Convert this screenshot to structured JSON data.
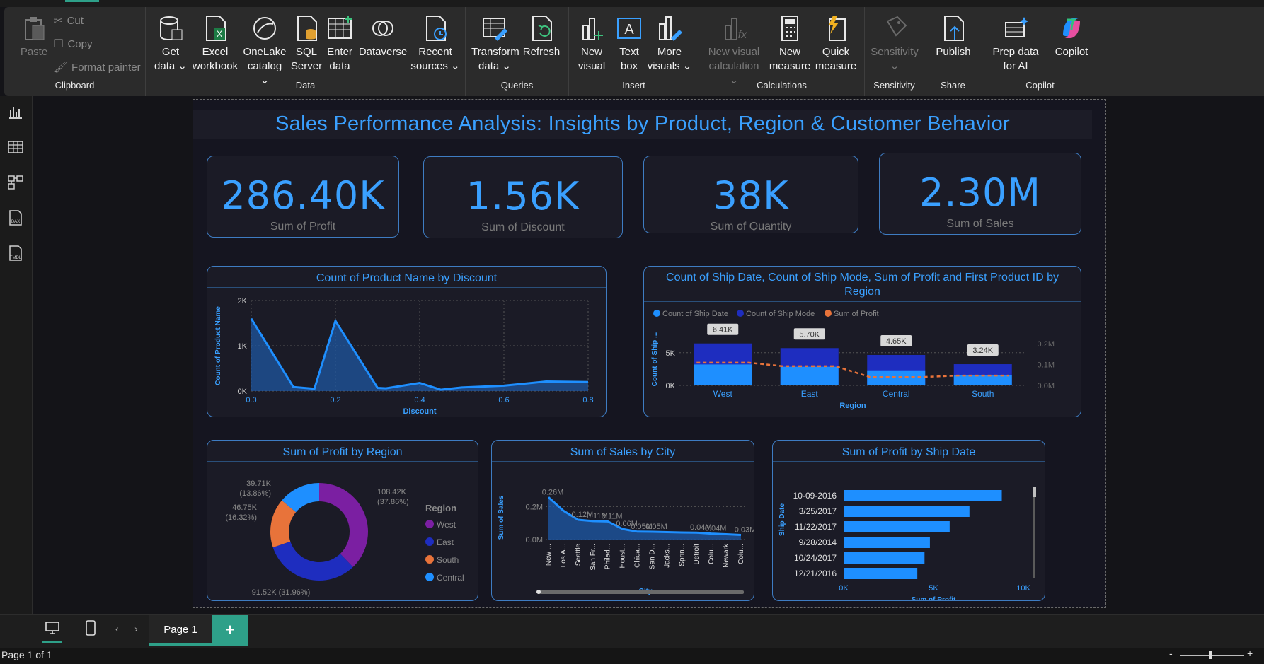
{
  "ribbon": {
    "clipboard": {
      "paste": "Paste",
      "cut": "Cut",
      "copy": "Copy",
      "format_painter": "Format painter",
      "label": "Clipboard"
    },
    "data": {
      "get_data": "Get data ⌄",
      "excel": "Excel workbook",
      "onelake": "OneLake catalog ⌄",
      "sql": "SQL Server",
      "enter": "Enter data",
      "dataverse": "Dataverse",
      "recent": "Recent sources ⌄",
      "label": "Data"
    },
    "queries": {
      "transform": "Transform data ⌄",
      "refresh": "Refresh",
      "label": "Queries"
    },
    "insert": {
      "new_visual": "New visual",
      "text_box": "Text box",
      "more_visuals": "More visuals ⌄",
      "label": "Insert"
    },
    "calculations": {
      "new_visual_calc": "New visual calculation ⌄",
      "new_measure": "New measure",
      "quick_measure": "Quick measure",
      "label": "Calculations"
    },
    "sensitivity": {
      "btn": "Sensitivity ⌄",
      "label": "Sensitivity"
    },
    "share": {
      "publish": "Publish",
      "label": "Share"
    },
    "copilot": {
      "prep": "Prep data for AI",
      "copilot": "Copilot",
      "label": "Copilot"
    }
  },
  "report": {
    "title": "Sales Performance Analysis: Insights by Product, Region & Customer Behavior",
    "cards": [
      {
        "value": "286.40K",
        "label": "Sum of Profit"
      },
      {
        "value": "1.56K",
        "label": "Sum of Discount"
      },
      {
        "value": "38K",
        "label": "Sum of Quantity"
      },
      {
        "value": "2.30M",
        "label": "Sum of Sales"
      }
    ],
    "panels": {
      "discount_title": "Count of Product Name by Discount",
      "region_combo_title": "Count of Ship Date, Count of Ship Mode, Sum of Profit and First Product ID by Region",
      "profit_region_title": "Sum of Profit by Region",
      "sales_city_title": "Sum of Sales by City",
      "profit_shipdate_title": "Sum of Profit by Ship Date"
    }
  },
  "chart_data": [
    {
      "type": "area",
      "title": "Count of Product Name by Discount",
      "xlabel": "Discount",
      "ylabel": "Count of Product Name",
      "x": [
        0.0,
        0.1,
        0.15,
        0.2,
        0.3,
        0.32,
        0.4,
        0.45,
        0.5,
        0.6,
        0.7,
        0.8
      ],
      "y": [
        1600,
        90,
        50,
        1550,
        70,
        60,
        180,
        30,
        80,
        120,
        210,
        200
      ],
      "xticks": [
        "0.0",
        "0.2",
        "0.4",
        "0.6",
        "0.8"
      ],
      "yticks": [
        "0K",
        "1K",
        "2K"
      ],
      "xlim": [
        0,
        0.8
      ],
      "ylim": [
        0,
        2000
      ]
    },
    {
      "type": "bar",
      "title": "Count of Ship Date, Count of Ship Mode, Sum of Profit and First Product ID by Region",
      "categories": [
        "West",
        "East",
        "Central",
        "South"
      ],
      "xlabel": "Region",
      "ylabel": "Count of Ship ...",
      "series": [
        {
          "name": "Count of Ship Date",
          "values": [
            3200,
            2850,
            2300,
            1620
          ]
        },
        {
          "name": "Count of Ship Mode",
          "values": [
            6410,
            5700,
            4650,
            3240
          ]
        },
        {
          "name": "Sum of Profit",
          "values": [
            108420,
            91520,
            39710,
            46750
          ]
        }
      ],
      "data_labels": [
        "6.41K",
        "5.70K",
        "4.65K",
        "3.24K"
      ],
      "yticks_left": [
        "0K",
        "5K"
      ],
      "yticks_right": [
        "0.0M",
        "0.1M",
        "0.2M"
      ]
    },
    {
      "type": "pie",
      "title": "Sum of Profit by Region",
      "legend_title": "Region",
      "categories": [
        "West",
        "East",
        "South",
        "Central"
      ],
      "values": [
        108420,
        91520,
        46750,
        39710
      ],
      "labels": [
        "108.42K (37.86%)",
        "91.52K (31.96%)",
        "46.75K (16.32%)",
        "39.71K (13.86%)"
      ],
      "colors": [
        "#7b1fa2",
        "#1e2dbf",
        "#e8733a",
        "#1e8fff"
      ]
    },
    {
      "type": "area",
      "title": "Sum of Sales by City",
      "xlabel": "City",
      "ylabel": "Sum of Sales",
      "categories": [
        "New ...",
        "Los A...",
        "Seattle",
        "San Fr...",
        "Philad...",
        "Houst...",
        "Chica...",
        "San D...",
        "Jacks...",
        "Sprin...",
        "Detroit",
        "Colu...",
        "Newark",
        "Colu..."
      ],
      "values": [
        256000,
        175000,
        120000,
        112000,
        110000,
        64000,
        48000,
        47000,
        45000,
        43000,
        42000,
        36000,
        32000,
        28000
      ],
      "data_labels": [
        "0.26M",
        "",
        "0.12M",
        "0.11M",
        "0.11M",
        "0.06M",
        "0.05M",
        "0.05M",
        "",
        "",
        "0.04M",
        "0.04M",
        "",
        "0.03M"
      ],
      "yticks": [
        "0.0M",
        "0.2M"
      ]
    },
    {
      "type": "bar",
      "orientation": "horizontal",
      "title": "Sum of Profit by Ship Date",
      "xlabel": "Sum of Profit",
      "ylabel": "Ship Date",
      "categories": [
        "10-09-2016",
        "3/25/2017",
        "11/22/2017",
        "9/28/2014",
        "10/24/2017",
        "12/21/2016"
      ],
      "values": [
        8800,
        7000,
        5900,
        4800,
        4500,
        4100
      ],
      "xticks": [
        "0K",
        "5K",
        "10K"
      ],
      "xlim": [
        0,
        10000
      ]
    }
  ],
  "bottom": {
    "page_tab": "Page 1",
    "add": "+",
    "status": "Page 1 of 1",
    "zoom_minus": "-",
    "zoom_plus": "+"
  },
  "leftbar": {
    "icons": [
      "report-view-icon",
      "table-view-icon",
      "model-view-icon",
      "dax-query-icon",
      "tmdl-view-icon"
    ]
  }
}
